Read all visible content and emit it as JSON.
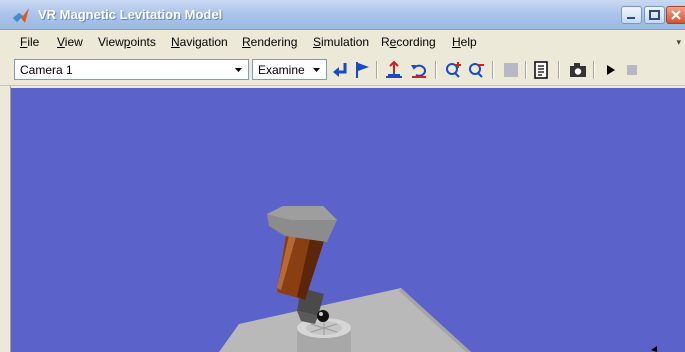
{
  "window": {
    "title": "VR Magnetic Levitation Model"
  },
  "menu": {
    "items": [
      {
        "label": "File",
        "mnemonic": "F",
        "rest": "ile"
      },
      {
        "label": "View",
        "mnemonic": "V",
        "rest": "iew"
      },
      {
        "label": "Viewpoints",
        "pre": "View",
        "mnemonic": "p",
        "rest": "oints"
      },
      {
        "label": "Navigation",
        "mnemonic": "N",
        "rest": "avigation"
      },
      {
        "label": "Rendering",
        "mnemonic": "R",
        "rest": "endering"
      },
      {
        "label": "Simulation",
        "mnemonic": "S",
        "rest": "imulation"
      },
      {
        "label": "Recording",
        "pre": "R",
        "mnemonic": "e",
        "rest": "cording"
      },
      {
        "label": "Help",
        "mnemonic": "H",
        "rest": "elp"
      }
    ]
  },
  "toolbar": {
    "viewpoint_value": "Camera 1",
    "navigation_mode": "Examine"
  },
  "colors": {
    "viewport_bg": "#5b62c9",
    "platform": "#b9b9b9",
    "magnet_cap": "#8c8c8c",
    "coil": "#8a3f12"
  }
}
